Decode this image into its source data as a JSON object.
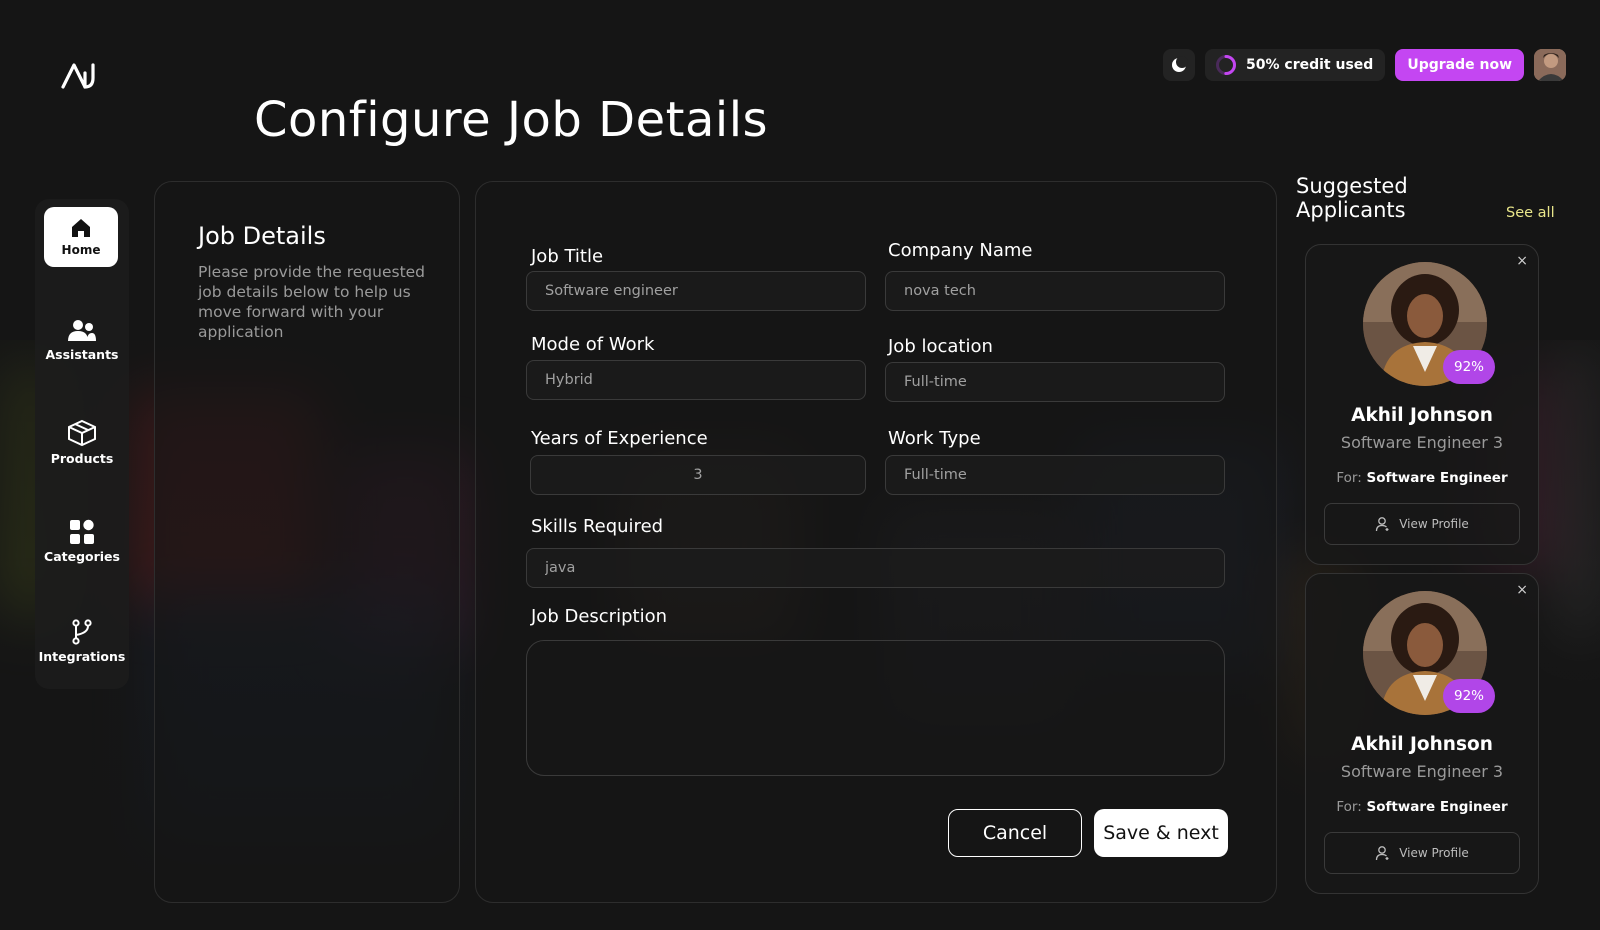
{
  "app": {
    "logo_icon": "ai-logo-icon"
  },
  "header": {
    "title": "Configure Job Details",
    "theme_icon": "moon-icon",
    "credit_text": "50% credit used",
    "credit_fraction": 0.5,
    "upgrade_label": "Upgrade now",
    "accent_color": "#c446f2"
  },
  "sidebar": {
    "items": [
      {
        "label": "Home",
        "icon": "home-icon",
        "active": true
      },
      {
        "label": "Assistants",
        "icon": "users-icon",
        "active": false
      },
      {
        "label": "Products",
        "icon": "box-icon",
        "active": false
      },
      {
        "label": "Categories",
        "icon": "grid-icon",
        "active": false
      },
      {
        "label": "Integrations",
        "icon": "branch-icon",
        "active": false
      }
    ]
  },
  "info": {
    "title": "Job Details",
    "description": "Please provide the requested job details below to help us move forward with your application"
  },
  "form": {
    "job_title": {
      "label": "Job Title",
      "value": "Software engineer"
    },
    "company_name": {
      "label": "Company Name",
      "value": "nova tech"
    },
    "mode_of_work": {
      "label": "Mode of Work",
      "value": "Hybrid"
    },
    "job_location": {
      "label": "Job location",
      "value": "Full-time"
    },
    "years_experience": {
      "label": "Years of Experience",
      "value": "3"
    },
    "work_type": {
      "label": "Work Type",
      "value": "Full-time"
    },
    "skills": {
      "label": "Skills Required",
      "value": "java"
    },
    "description": {
      "label": "Job Description",
      "value": ""
    },
    "cancel_label": "Cancel",
    "save_label": "Save & next"
  },
  "suggested": {
    "title": "Suggested Applicants",
    "see_all": "See all",
    "applicants": [
      {
        "name": "Akhil Johnson",
        "role": "Software Engineer 3",
        "for_label": "For:",
        "for_value": "Software Engineer",
        "match": "92%",
        "view_label": "View Profile",
        "close": "×"
      },
      {
        "name": "Akhil Johnson",
        "role": "Software Engineer 3",
        "for_label": "For:",
        "for_value": "Software Engineer",
        "match": "92%",
        "view_label": "View Profile",
        "close": "×"
      }
    ]
  }
}
